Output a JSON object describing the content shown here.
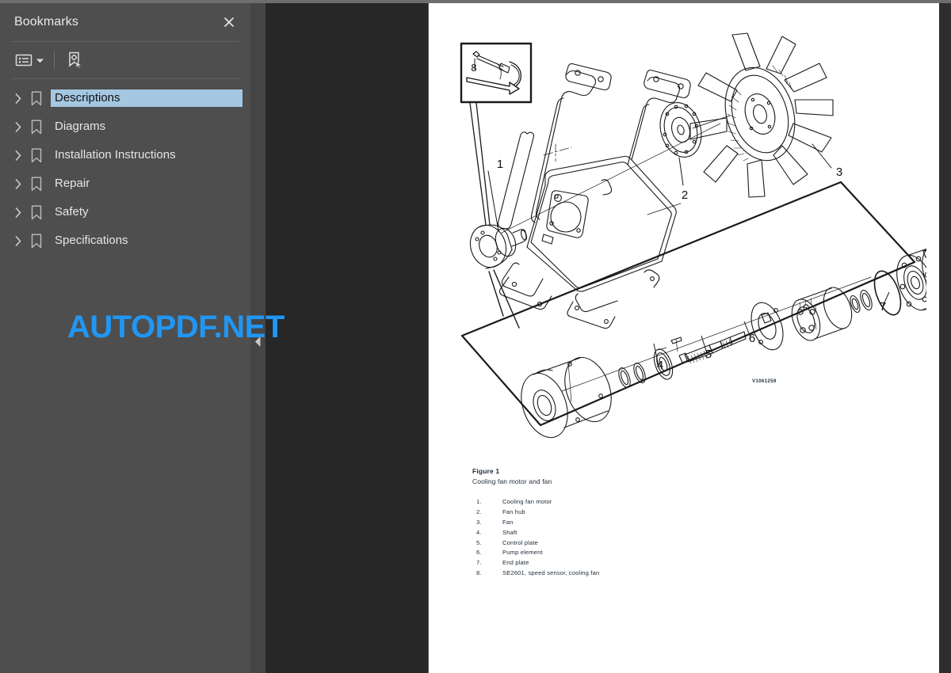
{
  "window": {
    "background_color": "#262626"
  },
  "sidebar": {
    "title": "Bookmarks",
    "close_icon": "close-icon",
    "toolbar": {
      "options_icon": "list-options-icon",
      "options_caret_icon": "chevron-down-icon",
      "new_bookmark_icon": "new-bookmark-icon"
    },
    "items": [
      {
        "label": "Descriptions",
        "expand_icon": "chevron-right-icon",
        "bookmark_icon": "bookmark-icon",
        "selected": true
      },
      {
        "label": "Diagrams",
        "expand_icon": "chevron-right-icon",
        "bookmark_icon": "bookmark-icon",
        "selected": false
      },
      {
        "label": "Installation Instructions",
        "expand_icon": "chevron-right-icon",
        "bookmark_icon": "bookmark-icon",
        "selected": false
      },
      {
        "label": "Repair",
        "expand_icon": "chevron-right-icon",
        "bookmark_icon": "bookmark-icon",
        "selected": false
      },
      {
        "label": "Safety",
        "expand_icon": "chevron-right-icon",
        "bookmark_icon": "bookmark-icon",
        "selected": false
      },
      {
        "label": "Specifications",
        "expand_icon": "chevron-right-icon",
        "bookmark_icon": "bookmark-icon",
        "selected": false
      }
    ],
    "selection_color": "#a4c7e2"
  },
  "splitter": {
    "collapse_icon": "collapse-left-icon"
  },
  "document": {
    "figure": {
      "title": "Figure 1",
      "subtitle": "Cooling fan motor and fan",
      "drawing_id": "V1061259",
      "callout_labels": [
        "1",
        "2",
        "3",
        "4",
        "5",
        "6",
        "7",
        "8"
      ],
      "legend": [
        {
          "num": "1.",
          "text": "Cooling fan motor"
        },
        {
          "num": "2.",
          "text": "Fan hub"
        },
        {
          "num": "3.",
          "text": "Fan"
        },
        {
          "num": "4.",
          "text": "Shaft"
        },
        {
          "num": "5.",
          "text": "Control plate"
        },
        {
          "num": "6.",
          "text": "Pump element"
        },
        {
          "num": "7.",
          "text": "End plate"
        },
        {
          "num": "8.",
          "text": "SE2601, speed sensor, cooling fan"
        }
      ]
    }
  },
  "watermark": {
    "text": "AUTOPDF.NET",
    "color": "#2196f3"
  }
}
